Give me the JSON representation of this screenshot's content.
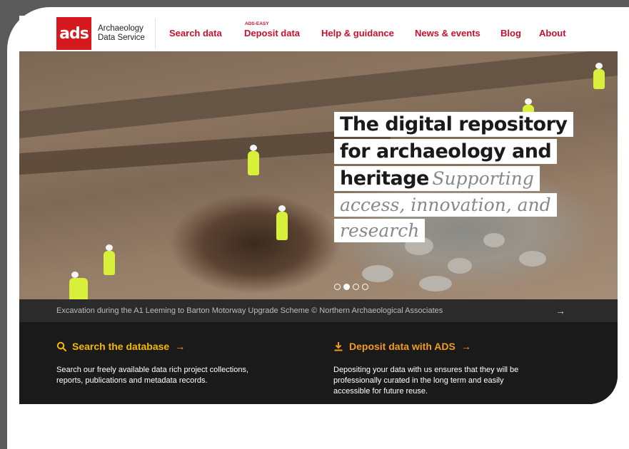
{
  "logo": {
    "mark": "ads",
    "line1": "Archaeology",
    "line2": "Data Service"
  },
  "nav": {
    "items": [
      "Search data",
      "Deposit data",
      "Help & guidance",
      "News & events",
      "Blog",
      "About"
    ],
    "deposit_tag": "ADS-EASY"
  },
  "hero": {
    "line1": "The digital repository",
    "line2": "for archaeology and",
    "line3_bold": "heritage",
    "line3_italic": "Supporting",
    "line4": "access, innovation, and",
    "line5": "research",
    "carousel_active_index": 1,
    "carousel_count": 4
  },
  "caption": {
    "text": "Excavation during the A1 Leeming to Barton Motorway Upgrade Scheme © Northern Archaeological Associates",
    "arrow": "→"
  },
  "cards": {
    "search": {
      "icon": "search-icon",
      "title": "Search the database",
      "arrow": "→",
      "desc_line1": "Search our freely available data rich project collections,",
      "desc_line2": "reports, publications and metadata records."
    },
    "deposit": {
      "icon": "download-icon",
      "title": "Deposit data with ADS",
      "arrow": "→",
      "desc_line1": "Depositing your data with us ensures that they will be",
      "desc_line2": "professionally curated in the long term and easily",
      "desc_line3": "accessible for future reuse."
    }
  },
  "colors": {
    "brand_red": "#d6181f",
    "nav_red": "#c8102e",
    "search_yellow": "#f5b800",
    "deposit_orange": "#f39b1e"
  }
}
